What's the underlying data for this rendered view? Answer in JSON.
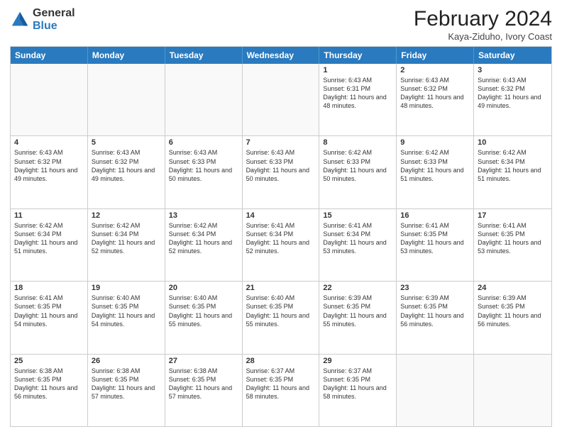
{
  "logo": {
    "general": "General",
    "blue": "Blue"
  },
  "title": {
    "month": "February 2024",
    "location": "Kaya-Ziduho, Ivory Coast"
  },
  "header_days": [
    "Sunday",
    "Monday",
    "Tuesday",
    "Wednesday",
    "Thursday",
    "Friday",
    "Saturday"
  ],
  "weeks": [
    [
      {
        "day": "",
        "info": "",
        "empty": true
      },
      {
        "day": "",
        "info": "",
        "empty": true
      },
      {
        "day": "",
        "info": "",
        "empty": true
      },
      {
        "day": "",
        "info": "",
        "empty": true
      },
      {
        "day": "1",
        "info": "Sunrise: 6:43 AM\nSunset: 6:31 PM\nDaylight: 11 hours\nand 48 minutes."
      },
      {
        "day": "2",
        "info": "Sunrise: 6:43 AM\nSunset: 6:32 PM\nDaylight: 11 hours\nand 48 minutes."
      },
      {
        "day": "3",
        "info": "Sunrise: 6:43 AM\nSunset: 6:32 PM\nDaylight: 11 hours\nand 49 minutes."
      }
    ],
    [
      {
        "day": "4",
        "info": "Sunrise: 6:43 AM\nSunset: 6:32 PM\nDaylight: 11 hours\nand 49 minutes."
      },
      {
        "day": "5",
        "info": "Sunrise: 6:43 AM\nSunset: 6:32 PM\nDaylight: 11 hours\nand 49 minutes."
      },
      {
        "day": "6",
        "info": "Sunrise: 6:43 AM\nSunset: 6:33 PM\nDaylight: 11 hours\nand 50 minutes."
      },
      {
        "day": "7",
        "info": "Sunrise: 6:43 AM\nSunset: 6:33 PM\nDaylight: 11 hours\nand 50 minutes."
      },
      {
        "day": "8",
        "info": "Sunrise: 6:42 AM\nSunset: 6:33 PM\nDaylight: 11 hours\nand 50 minutes."
      },
      {
        "day": "9",
        "info": "Sunrise: 6:42 AM\nSunset: 6:33 PM\nDaylight: 11 hours\nand 51 minutes."
      },
      {
        "day": "10",
        "info": "Sunrise: 6:42 AM\nSunset: 6:34 PM\nDaylight: 11 hours\nand 51 minutes."
      }
    ],
    [
      {
        "day": "11",
        "info": "Sunrise: 6:42 AM\nSunset: 6:34 PM\nDaylight: 11 hours\nand 51 minutes."
      },
      {
        "day": "12",
        "info": "Sunrise: 6:42 AM\nSunset: 6:34 PM\nDaylight: 11 hours\nand 52 minutes."
      },
      {
        "day": "13",
        "info": "Sunrise: 6:42 AM\nSunset: 6:34 PM\nDaylight: 11 hours\nand 52 minutes."
      },
      {
        "day": "14",
        "info": "Sunrise: 6:41 AM\nSunset: 6:34 PM\nDaylight: 11 hours\nand 52 minutes."
      },
      {
        "day": "15",
        "info": "Sunrise: 6:41 AM\nSunset: 6:34 PM\nDaylight: 11 hours\nand 53 minutes."
      },
      {
        "day": "16",
        "info": "Sunrise: 6:41 AM\nSunset: 6:35 PM\nDaylight: 11 hours\nand 53 minutes."
      },
      {
        "day": "17",
        "info": "Sunrise: 6:41 AM\nSunset: 6:35 PM\nDaylight: 11 hours\nand 53 minutes."
      }
    ],
    [
      {
        "day": "18",
        "info": "Sunrise: 6:41 AM\nSunset: 6:35 PM\nDaylight: 11 hours\nand 54 minutes."
      },
      {
        "day": "19",
        "info": "Sunrise: 6:40 AM\nSunset: 6:35 PM\nDaylight: 11 hours\nand 54 minutes."
      },
      {
        "day": "20",
        "info": "Sunrise: 6:40 AM\nSunset: 6:35 PM\nDaylight: 11 hours\nand 55 minutes."
      },
      {
        "day": "21",
        "info": "Sunrise: 6:40 AM\nSunset: 6:35 PM\nDaylight: 11 hours\nand 55 minutes."
      },
      {
        "day": "22",
        "info": "Sunrise: 6:39 AM\nSunset: 6:35 PM\nDaylight: 11 hours\nand 55 minutes."
      },
      {
        "day": "23",
        "info": "Sunrise: 6:39 AM\nSunset: 6:35 PM\nDaylight: 11 hours\nand 56 minutes."
      },
      {
        "day": "24",
        "info": "Sunrise: 6:39 AM\nSunset: 6:35 PM\nDaylight: 11 hours\nand 56 minutes."
      }
    ],
    [
      {
        "day": "25",
        "info": "Sunrise: 6:38 AM\nSunset: 6:35 PM\nDaylight: 11 hours\nand 56 minutes."
      },
      {
        "day": "26",
        "info": "Sunrise: 6:38 AM\nSunset: 6:35 PM\nDaylight: 11 hours\nand 57 minutes."
      },
      {
        "day": "27",
        "info": "Sunrise: 6:38 AM\nSunset: 6:35 PM\nDaylight: 11 hours\nand 57 minutes."
      },
      {
        "day": "28",
        "info": "Sunrise: 6:37 AM\nSunset: 6:35 PM\nDaylight: 11 hours\nand 58 minutes."
      },
      {
        "day": "29",
        "info": "Sunrise: 6:37 AM\nSunset: 6:35 PM\nDaylight: 11 hours\nand 58 minutes."
      },
      {
        "day": "",
        "info": "",
        "empty": true
      },
      {
        "day": "",
        "info": "",
        "empty": true
      }
    ]
  ]
}
